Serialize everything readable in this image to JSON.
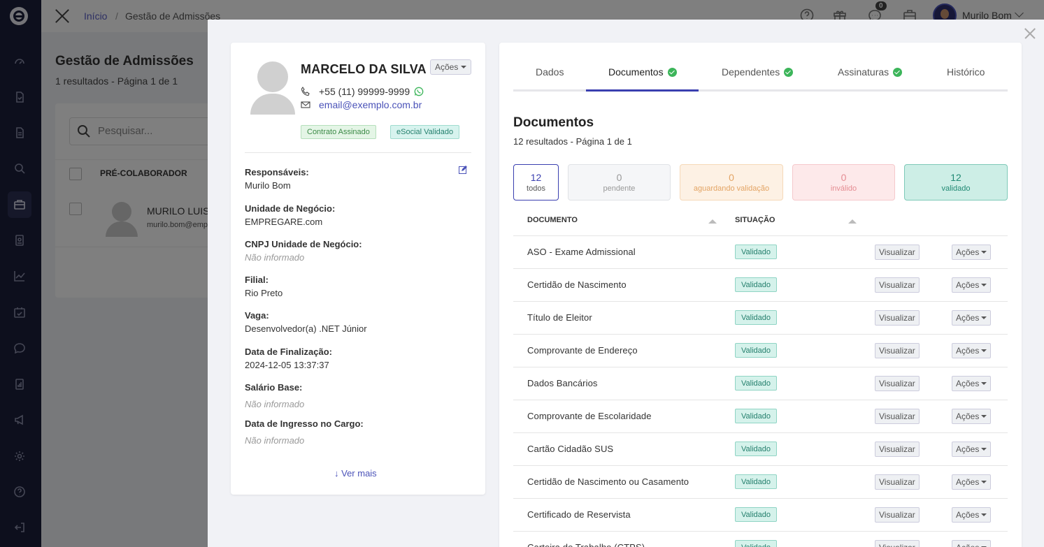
{
  "topbar": {
    "breadcrumb_home": "Início",
    "breadcrumb_sep": "/",
    "breadcrumb_current": "Gestão de Admissões",
    "messages_count": "0",
    "user_name": "Murilo Bom"
  },
  "background": {
    "title": "Gestão de Admissões",
    "summary": "1 resultados - Página 1 de 1",
    "search_placeholder": "Pesquisar...",
    "column": "PRÉ-COLABORADOR",
    "row_name": "MURILO LUIS",
    "row_email": "murilo.bom@emp"
  },
  "profile": {
    "name": "MARCELO DA SILVA",
    "actions_label": "Ações",
    "phone": "+55 (11) 99999-9999",
    "email": "email@exemplo.com.br",
    "badges": [
      "Contrato Assinado",
      "eSocial Validado"
    ],
    "fields": [
      {
        "label": "Responsáveis:",
        "value": "Murilo Bom"
      },
      {
        "label": "Unidade de Negócio:",
        "value": "EMPREGARE.com"
      },
      {
        "label": "CNPJ Unidade de Negócio:",
        "value": "Não informado"
      },
      {
        "label": "Filial:",
        "value": "Rio Preto"
      },
      {
        "label": "Vaga:",
        "value": "Desenvolvedor(a) .NET Júnior"
      },
      {
        "label": "Data de Finalização:",
        "value": "2024-12-05 13:37:37"
      },
      {
        "label": "Salário Base:",
        "value": "Não informado"
      },
      {
        "label": "Data de Ingresso no Cargo:",
        "value": "Não informado"
      }
    ],
    "ver_mais": "↓ Ver mais"
  },
  "tabs": [
    {
      "label": "Dados",
      "checked": false
    },
    {
      "label": "Documentos",
      "checked": true,
      "active": true
    },
    {
      "label": "Dependentes",
      "checked": true
    },
    {
      "label": "Assinaturas",
      "checked": true
    },
    {
      "label": "Histórico",
      "checked": false
    }
  ],
  "documents": {
    "title": "Documentos",
    "summary": "12 resultados - Página 1 de 1",
    "filters": [
      {
        "count": "12",
        "label": "todos"
      },
      {
        "count": "0",
        "label": "pendente"
      },
      {
        "count": "0",
        "label": "aguardando validação"
      },
      {
        "count": "0",
        "label": "inválido"
      },
      {
        "count": "12",
        "label": "validado"
      }
    ],
    "columns": [
      "DOCUMENTO",
      "SITUAÇÃO"
    ],
    "view_label": "Visualizar",
    "actions_label": "Ações",
    "rows": [
      {
        "name": "ASO - Exame Admissional",
        "status": "Validado"
      },
      {
        "name": "Certidão de Nascimento",
        "status": "Validado"
      },
      {
        "name": "Título de Eleitor",
        "status": "Validado"
      },
      {
        "name": "Comprovante de Endereço",
        "status": "Validado"
      },
      {
        "name": "Dados Bancários",
        "status": "Validado"
      },
      {
        "name": "Comprovante de Escolaridade",
        "status": "Validado"
      },
      {
        "name": "Cartão Cidadão SUS",
        "status": "Validado"
      },
      {
        "name": "Certidão de Nascimento ou Casamento",
        "status": "Validado"
      },
      {
        "name": "Certificado de Reservista",
        "status": "Validado"
      },
      {
        "name": "Carteira de Trabalho (CTPS)",
        "status": "Validado"
      }
    ]
  },
  "colors": {
    "sidebar": "#1b1e3a",
    "accent": "#3a3fb0",
    "valid_bg": "#d5f2eb",
    "valid_text": "#26806e"
  }
}
